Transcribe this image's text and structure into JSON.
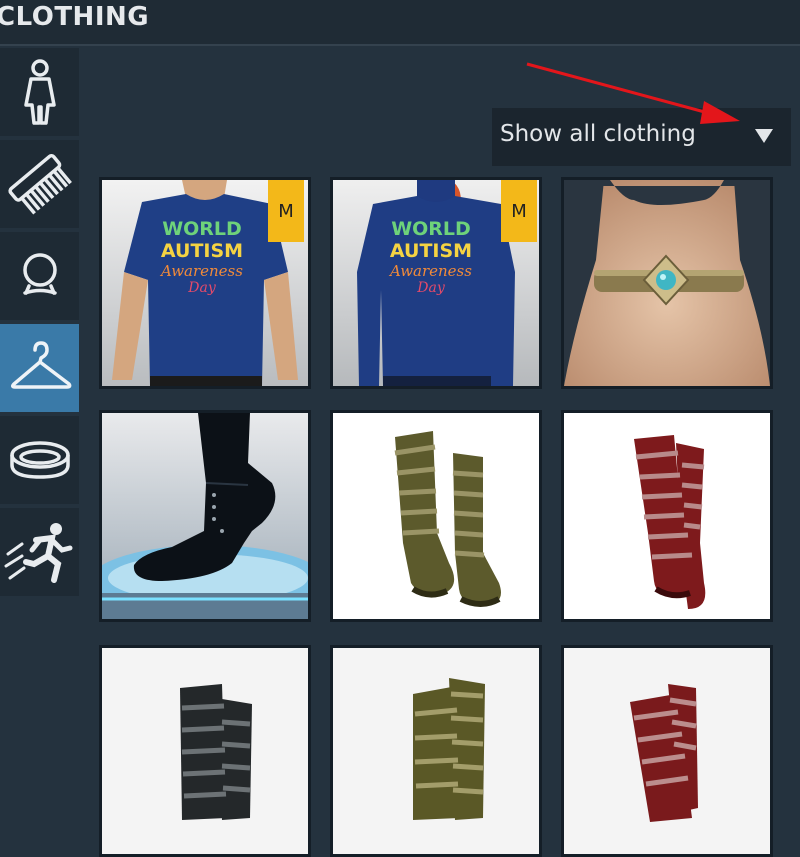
{
  "header": {
    "title": "CLOTHING"
  },
  "sidebar": {
    "items": [
      {
        "icon": "body-figure-icon"
      },
      {
        "icon": "comb-icon"
      },
      {
        "icon": "necklace-icon"
      },
      {
        "icon": "hanger-icon",
        "active": true
      },
      {
        "icon": "bracelet-icon"
      },
      {
        "icon": "running-figure-icon"
      }
    ]
  },
  "filter": {
    "label": "Show all clothing",
    "icon": "caret-down-icon"
  },
  "items": [
    {
      "kind": "tshirt",
      "badge": "M",
      "print": [
        "WORLD",
        "AUTISM",
        "Awareness",
        "Day"
      ]
    },
    {
      "kind": "sweater",
      "badge": "M",
      "print": [
        "WORLD",
        "AUTISM",
        "Awareness",
        "Day"
      ]
    },
    {
      "kind": "choker"
    },
    {
      "kind": "black-boot"
    },
    {
      "kind": "olive-buckle-boots"
    },
    {
      "kind": "red-buckle-boots"
    },
    {
      "kind": "black-buckle-boots"
    },
    {
      "kind": "olive-buckle-boots"
    },
    {
      "kind": "red-buckle-boots"
    }
  ],
  "colors": {
    "active_tab": "#3a7aa8",
    "badge": "#f3b819",
    "arrow": "#e3161b"
  }
}
